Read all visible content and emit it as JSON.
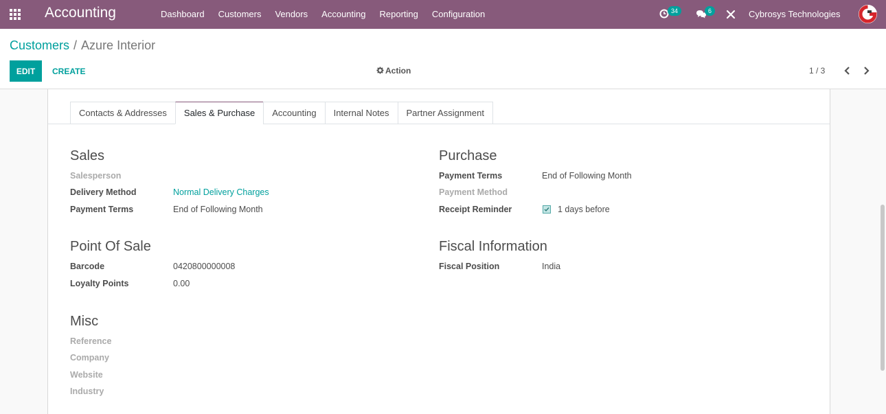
{
  "navbar": {
    "app_title": "Accounting",
    "menu": [
      "Dashboard",
      "Customers",
      "Vendors",
      "Accounting",
      "Reporting",
      "Configuration"
    ],
    "activity_count": "34",
    "message_count": "6",
    "company": "Cybrosys Technologies",
    "colors": {
      "bg": "#875a7b",
      "badge": "#00a09d"
    }
  },
  "control_panel": {
    "breadcrumb_parent": "Customers",
    "breadcrumb_sep": "/",
    "breadcrumb_current": "Azure Interior",
    "edit_label": "EDIT",
    "create_label": "CREATE",
    "action_label": "Action",
    "pager": "1 / 3"
  },
  "tabs": [
    "Contacts & Addresses",
    "Sales & Purchase",
    "Accounting",
    "Internal Notes",
    "Partner Assignment"
  ],
  "form": {
    "sales": {
      "title": "Sales",
      "salesperson_label": "Salesperson",
      "delivery_label": "Delivery Method",
      "delivery_value": "Normal Delivery Charges",
      "payment_terms_label": "Payment Terms",
      "payment_terms_value": "End of Following Month"
    },
    "purchase": {
      "title": "Purchase",
      "payment_terms_label": "Payment Terms",
      "payment_terms_value": "End of Following Month",
      "payment_method_label": "Payment Method",
      "receipt_label": "Receipt Reminder",
      "receipt_value": "1 days before"
    },
    "pos": {
      "title": "Point Of Sale",
      "barcode_label": "Barcode",
      "barcode_value": "0420800000008",
      "loyalty_label": "Loyalty Points",
      "loyalty_value": "0.00"
    },
    "fiscal": {
      "title": "Fiscal Information",
      "position_label": "Fiscal Position",
      "position_value": "India"
    },
    "misc": {
      "title": "Misc",
      "reference_label": "Reference",
      "company_label": "Company",
      "website_label": "Website",
      "industry_label": "Industry"
    }
  }
}
